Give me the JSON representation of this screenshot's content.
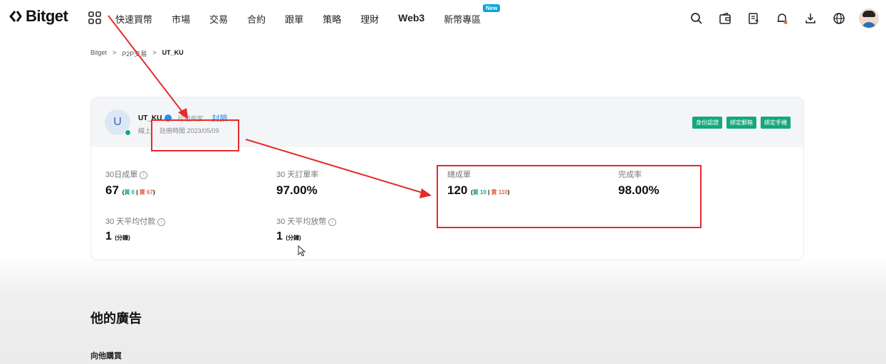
{
  "nav": {
    "logo": "Bitget",
    "grid_icon": "apps-grid-icon",
    "menu": [
      "快速買幣",
      "市場",
      "交易",
      "合約",
      "跟單",
      "策略",
      "理財",
      "Web3",
      "新幣專區"
    ],
    "new_badge": "New",
    "icons": [
      "search-icon",
      "wallet-icon",
      "orders-icon",
      "bell-icon",
      "download-icon",
      "globe-icon",
      "avatar"
    ]
  },
  "breadcrumb": [
    "Bitget",
    "P2P交易",
    "UT_KU"
  ],
  "profile": {
    "avatar_letter": "U",
    "name": "UT_KU",
    "merchant": "認證商家",
    "block": "封鎖",
    "status": "線上",
    "register": "註冊時間 2023/05/09",
    "badges": [
      "身份認證",
      "綁定郵箱",
      "綁定手機"
    ]
  },
  "stats": {
    "orders30_label": "30日成單",
    "orders30_value": "67",
    "orders30_buy": "買 0",
    "orders30_sell": "賣 67",
    "rate30_label": "30 天訂單率",
    "rate30_value": "97.00%",
    "total_label": "總成單",
    "total_value": "120",
    "total_buy": "買 10",
    "total_sell": "賣 110",
    "completion_label": "完成率",
    "completion_value": "98.00%",
    "avg_pay_label": "30 天平均付款",
    "avg_pay_value": "1",
    "avg_pay_unit": "(分鐘)",
    "avg_release_label": "30 天平均放幣",
    "avg_release_value": "1",
    "avg_release_unit": "(分鐘)"
  },
  "ads": {
    "title": "他的廣告",
    "buy_from": "向他購買"
  },
  "colors": {
    "accent": "#13a87d",
    "sell": "#e0664f",
    "annotation": "#e62a2a"
  }
}
